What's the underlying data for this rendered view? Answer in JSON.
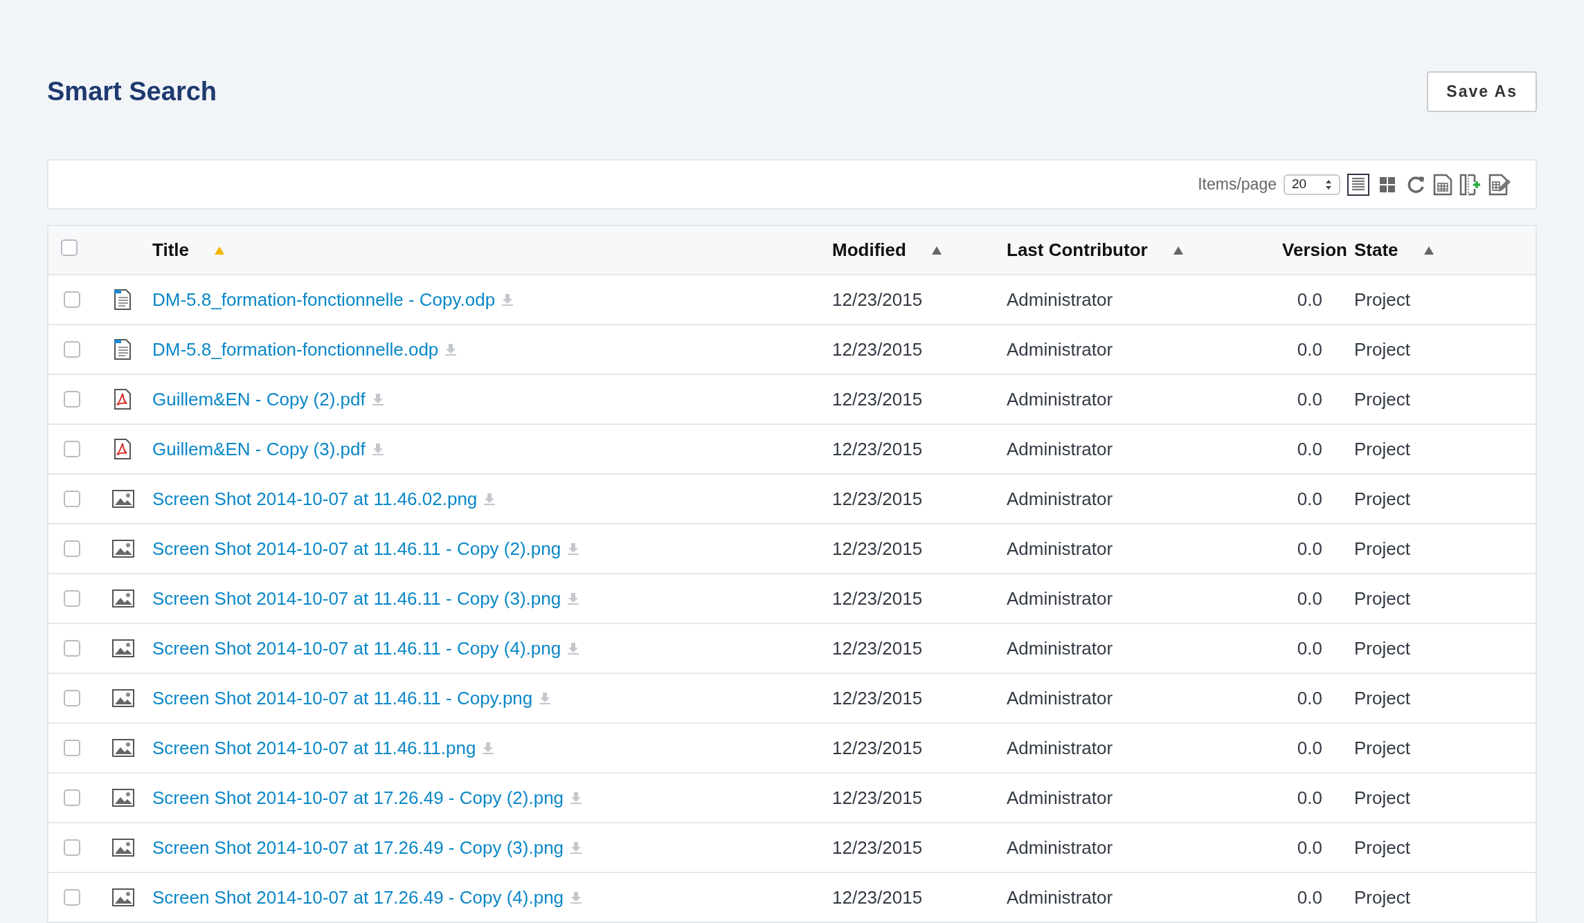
{
  "page": {
    "title": "Smart Search",
    "save_button": "Save As"
  },
  "toolbar": {
    "items_label": "Items/page",
    "items_value": "20",
    "views": [
      {
        "kind": "list",
        "selected": true
      },
      {
        "kind": "grid",
        "selected": false
      }
    ],
    "actions": [
      {
        "kind": "refresh"
      },
      {
        "kind": "spreadsheet"
      },
      {
        "kind": "add-column"
      },
      {
        "kind": "edit"
      }
    ]
  },
  "table": {
    "select_all_checked": false,
    "columns": [
      {
        "label": "Title",
        "sorted": true
      },
      {
        "label": "Modified",
        "sorted": false
      },
      {
        "label": "Last Contributor",
        "sorted": false
      },
      {
        "label": "Version"
      },
      {
        "label": "State",
        "sorted": false
      }
    ],
    "rows": [
      {
        "kind": "odp",
        "checked": false,
        "title": "DM-5.8_formation-fonctionnelle - Copy.odp",
        "modified": "12/23/2015",
        "contributor": "Administrator",
        "version": "0.0",
        "state": "Project"
      },
      {
        "kind": "odp",
        "checked": false,
        "title": "DM-5.8_formation-fonctionnelle.odp",
        "modified": "12/23/2015",
        "contributor": "Administrator",
        "version": "0.0",
        "state": "Project"
      },
      {
        "kind": "pdf",
        "checked": false,
        "title": "Guillem&EN - Copy (2).pdf",
        "modified": "12/23/2015",
        "contributor": "Administrator",
        "version": "0.0",
        "state": "Project"
      },
      {
        "kind": "pdf",
        "checked": false,
        "title": "Guillem&EN - Copy (3).pdf",
        "modified": "12/23/2015",
        "contributor": "Administrator",
        "version": "0.0",
        "state": "Project"
      },
      {
        "kind": "image",
        "checked": false,
        "title": "Screen Shot 2014-10-07 at 11.46.02.png",
        "modified": "12/23/2015",
        "contributor": "Administrator",
        "version": "0.0",
        "state": "Project"
      },
      {
        "kind": "image",
        "checked": false,
        "title": "Screen Shot 2014-10-07 at 11.46.11 - Copy (2).png",
        "modified": "12/23/2015",
        "contributor": "Administrator",
        "version": "0.0",
        "state": "Project"
      },
      {
        "kind": "image",
        "checked": false,
        "title": "Screen Shot 2014-10-07 at 11.46.11 - Copy (3).png",
        "modified": "12/23/2015",
        "contributor": "Administrator",
        "version": "0.0",
        "state": "Project"
      },
      {
        "kind": "image",
        "checked": false,
        "title": "Screen Shot 2014-10-07 at 11.46.11 - Copy (4).png",
        "modified": "12/23/2015",
        "contributor": "Administrator",
        "version": "0.0",
        "state": "Project"
      },
      {
        "kind": "image",
        "checked": false,
        "title": "Screen Shot 2014-10-07 at 11.46.11 - Copy.png",
        "modified": "12/23/2015",
        "contributor": "Administrator",
        "version": "0.0",
        "state": "Project"
      },
      {
        "kind": "image",
        "checked": false,
        "title": "Screen Shot 2014-10-07 at 11.46.11.png",
        "modified": "12/23/2015",
        "contributor": "Administrator",
        "version": "0.0",
        "state": "Project"
      },
      {
        "kind": "image",
        "checked": false,
        "title": "Screen Shot 2014-10-07 at 17.26.49 - Copy (2).png",
        "modified": "12/23/2015",
        "contributor": "Administrator",
        "version": "0.0",
        "state": "Project"
      },
      {
        "kind": "image",
        "checked": false,
        "title": "Screen Shot 2014-10-07 at 17.26.49 - Copy (3).png",
        "modified": "12/23/2015",
        "contributor": "Administrator",
        "version": "0.0",
        "state": "Project"
      },
      {
        "kind": "image",
        "checked": false,
        "title": "Screen Shot 2014-10-07 at 17.26.49 - Copy (4).png",
        "modified": "12/23/2015",
        "contributor": "Administrator",
        "version": "0.0",
        "state": "Project"
      }
    ]
  }
}
